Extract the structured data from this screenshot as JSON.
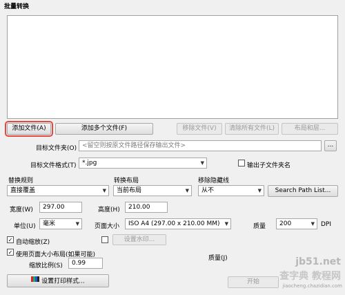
{
  "window": {
    "title": "批量转换"
  },
  "buttons": {
    "add_file": "添加文件(A)",
    "add_multiple": "添加多个文件(F)",
    "remove_file": "移除文件(V)",
    "clear_all": "清除所有文件(L)",
    "layout": "布局和层...",
    "more": "...",
    "search_path": "Search Path List...",
    "watermark": "设置水印...",
    "print_style": "设置打印样式...",
    "start": "开始"
  },
  "target_folder": {
    "label": "目标文件夹(O)",
    "placeholder": "<留空则按原文件路径保存输出文件>"
  },
  "target_format": {
    "label": "目标文件格式(T)",
    "value": "*.jpg"
  },
  "subfolder": {
    "label": "输出子文件夹名",
    "checked": false
  },
  "replace_rule": {
    "label": "替换规则",
    "value": "直接覆盖"
  },
  "convert_layout": {
    "label": "转换布局",
    "value": "当前布局"
  },
  "remove_hidden": {
    "label": "移除隐藏线",
    "value": "从不"
  },
  "width": {
    "label": "宽度(W)",
    "value": "297.00"
  },
  "height": {
    "label": "高度(H)",
    "value": "210.00"
  },
  "unit": {
    "label": "单位(U)",
    "value": "毫米"
  },
  "page_size": {
    "label": "页面大小",
    "value": "ISO A4 (297.00 x 210.00 MM)"
  },
  "quality_dpi": {
    "label": "质量",
    "value": "200",
    "unit": "DPI"
  },
  "auto_zoom": {
    "label": "自动缩放(Z)",
    "checked": true
  },
  "watermark_check": {
    "checked": false
  },
  "use_page_layout": {
    "label": "使用页面大小布局(如果可能)",
    "checked": true
  },
  "scale": {
    "label": "缩放比例(S)",
    "value": "0.99"
  },
  "quality_j": {
    "label": "质量(J)"
  },
  "watermark_text": {
    "site": "jb51.net",
    "brand": "查字典 教程网",
    "url": "jiaocheng.chazidian.com"
  }
}
